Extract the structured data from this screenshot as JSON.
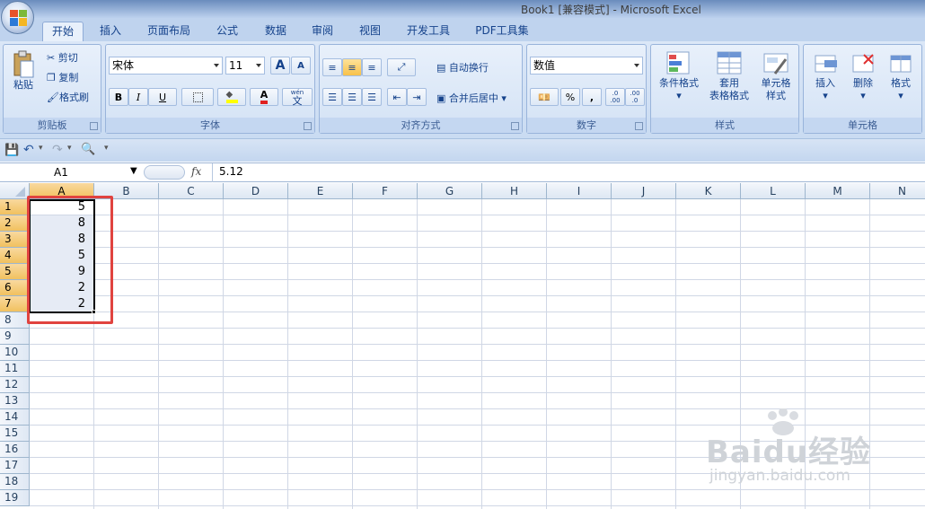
{
  "window": {
    "title": "Book1  [兼容模式] - Microsoft Excel"
  },
  "tabs": [
    "开始",
    "插入",
    "页面布局",
    "公式",
    "数据",
    "审阅",
    "视图",
    "开发工具",
    "PDF工具集"
  ],
  "active_tab": "开始",
  "ribbon": {
    "clipboard": {
      "label": "剪贴板",
      "paste": "粘贴",
      "cut": "剪切",
      "copy": "复制",
      "format_painter": "格式刷"
    },
    "font": {
      "label": "字体",
      "font_name": "宋体",
      "font_size": "11",
      "bold": "B",
      "italic": "I",
      "underline": "U",
      "grow": "A",
      "shrink": "A",
      "font_color_letter": "A",
      "phonetic": "wén",
      "phonetic_char": "文"
    },
    "alignment": {
      "label": "对齐方式",
      "wrap_text": "自动换行",
      "merge_center": "合并后居中"
    },
    "number": {
      "label": "数字",
      "format": "数值",
      "percent": "%",
      "comma": ",",
      "inc_decimal": ".0",
      "inc_decimal2": ".00",
      "dec_decimal": ".00",
      "dec_decimal2": ".0"
    },
    "styles": {
      "label": "样式",
      "conditional": "条件格式",
      "table_line1": "套用",
      "table_line2": "表格格式",
      "cell_line1": "单元格",
      "cell_line2": "样式"
    },
    "cells": {
      "label": "单元格",
      "insert": "插入",
      "delete": "删除",
      "format": "格式"
    }
  },
  "formula_bar": {
    "name_box": "A1",
    "fx": "fx",
    "value": "5.12"
  },
  "columns": [
    "A",
    "B",
    "C",
    "D",
    "E",
    "F",
    "G",
    "H",
    "I",
    "J",
    "K",
    "L",
    "M",
    "N"
  ],
  "rows": [
    "1",
    "2",
    "3",
    "4",
    "5",
    "6",
    "7",
    "8",
    "9",
    "10",
    "11",
    "12",
    "13",
    "14",
    "15",
    "16",
    "17",
    "18",
    "19"
  ],
  "cells_A": [
    "5",
    "8",
    "8",
    "5",
    "9",
    "2",
    "2"
  ],
  "watermark": {
    "brand": "Baidu经验",
    "url": "jingyan.baidu.com"
  },
  "colors": {
    "accent": "#15428b",
    "selection_red": "#e0433f"
  }
}
